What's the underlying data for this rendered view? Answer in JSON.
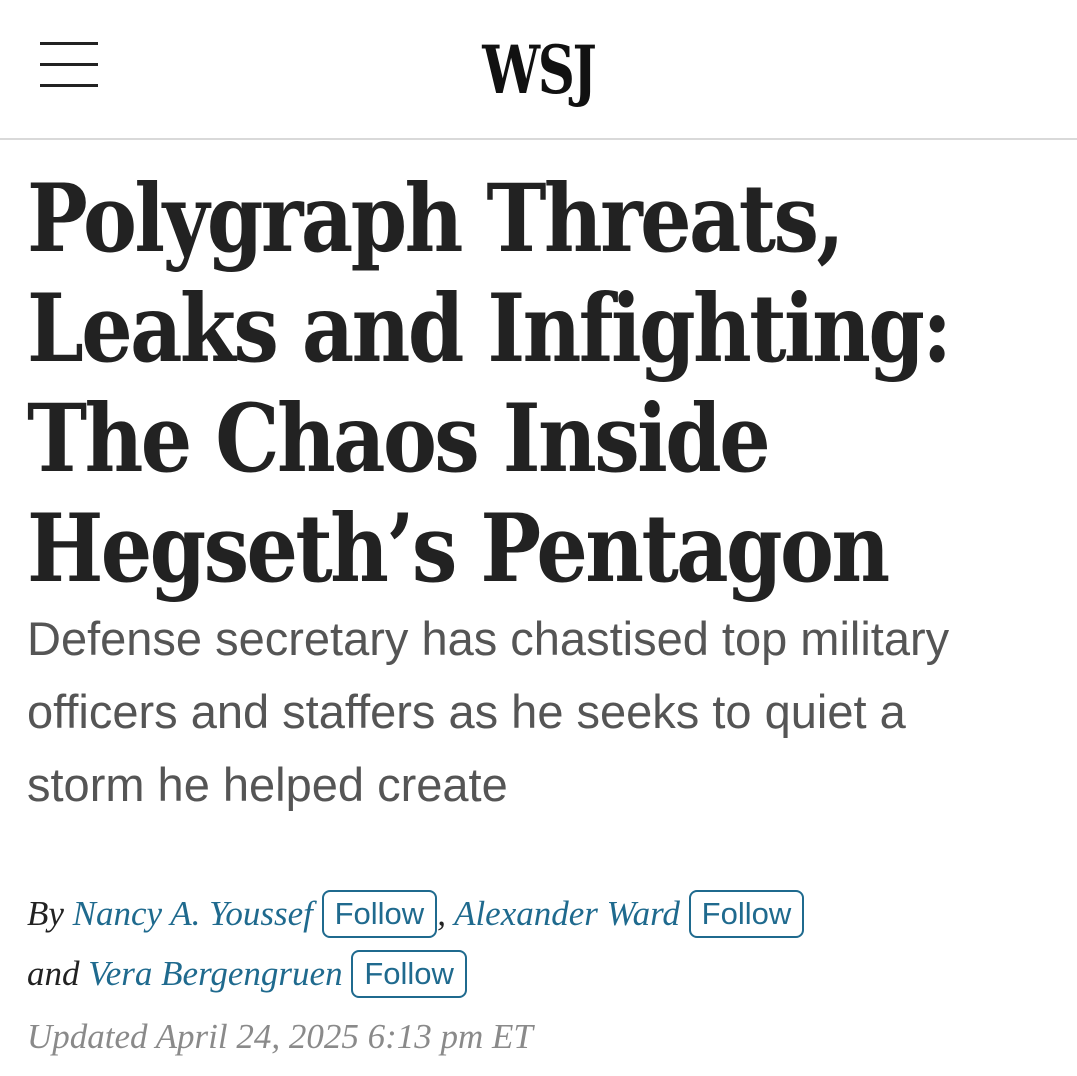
{
  "header": {
    "logo_text": "WSJ",
    "menu_icon": "hamburger-menu-icon"
  },
  "article": {
    "headline_lines": [
      "Polygraph Threats,",
      "Leaks and Infighting:",
      "The Chaos Inside",
      "Hegseth’s Pentagon"
    ],
    "dek_lines": [
      "Defense secretary has chastised top military",
      "officers and staffers as he seeks to quiet a",
      "storm he helped create"
    ],
    "byline": {
      "by_label": "By",
      "separator": ",",
      "and_label": "and",
      "follow_label": "Follow",
      "authors": [
        "Nancy A. Youssef",
        "Alexander Ward",
        "Vera Bergengruen"
      ]
    },
    "updated": "Updated April 24, 2025 6:13 pm ET"
  },
  "colors": {
    "author_link": "#1f6a8e",
    "headline": "#222222",
    "dek": "#555555",
    "timestamp": "#8a8a8a",
    "divider": "#d9d9d9"
  }
}
